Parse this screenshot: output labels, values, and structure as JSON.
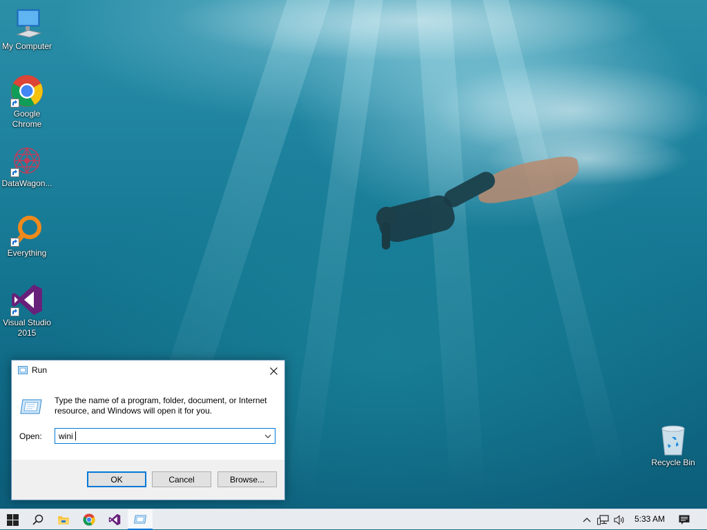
{
  "desktop": {
    "icons": [
      {
        "label": "My Computer",
        "icon": "computer-icon"
      },
      {
        "label": "Google\nChrome",
        "icon": "chrome-icon"
      },
      {
        "label": "DataWagon...",
        "icon": "datawagon-icon"
      },
      {
        "label": "Everything",
        "icon": "everything-icon"
      },
      {
        "label": "Visual Studio\n2015",
        "icon": "visual-studio-icon"
      },
      {
        "label": "Recycle Bin",
        "icon": "recycle-bin-icon"
      }
    ]
  },
  "run_dialog": {
    "title": "Run",
    "description": "Type the name of a program, folder, document, or Internet resource, and Windows will open it for you.",
    "open_label": "Open:",
    "open_value": "wini",
    "ok_label": "OK",
    "cancel_label": "Cancel",
    "browse_label": "Browse..."
  },
  "taskbar": {
    "buttons": [
      "start-icon",
      "search-icon",
      "file-explorer-icon",
      "chrome-icon",
      "visual-studio-icon",
      "run-icon"
    ],
    "active": "run-icon",
    "clock": "5:33 AM"
  },
  "colors": {
    "accent": "#0078d7",
    "taskbar_bg": "#e8ecf1",
    "dialog_footer": "#f0f0f0"
  }
}
